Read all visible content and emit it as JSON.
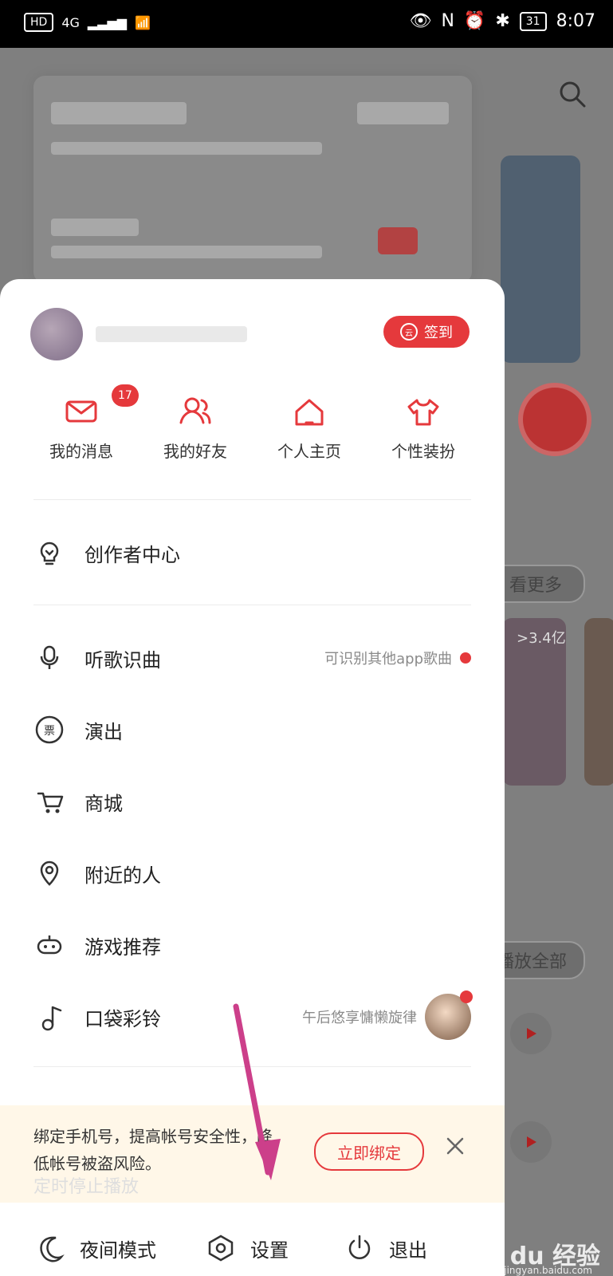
{
  "status_bar": {
    "left_labels": [
      "HD",
      "4G"
    ],
    "right_battery": "31",
    "time": "8:07"
  },
  "background": {
    "buttons": [
      "看更多",
      "播放全部"
    ],
    "video_count": ">3.4亿"
  },
  "panel": {
    "signin_label": "签到",
    "quick_actions": [
      {
        "label": "我的消息",
        "badge": "17"
      },
      {
        "label": "我的好友"
      },
      {
        "label": "个人主页"
      },
      {
        "label": "个性装扮"
      }
    ],
    "creator_center": "创作者中心",
    "menu": [
      {
        "label": "听歌识曲",
        "right_text": "可识别其他app歌曲"
      },
      {
        "label": "演出"
      },
      {
        "label": "商城"
      },
      {
        "label": "附近的人"
      },
      {
        "label": "游戏推荐"
      },
      {
        "label": "口袋彩铃",
        "right_text": "午后悠享慵懒旋律"
      }
    ],
    "notice": {
      "text": "绑定手机号，提高帐号安全性，降低帐号被盗风险。",
      "button": "立即绑定"
    },
    "hidden_row_label": "定时停止播放",
    "bottom": {
      "night": "夜间模式",
      "settings": "设置",
      "logout": "退出"
    }
  },
  "watermark": {
    "brand": "Bai du 经验",
    "url": "jingyan.baidu.com"
  }
}
